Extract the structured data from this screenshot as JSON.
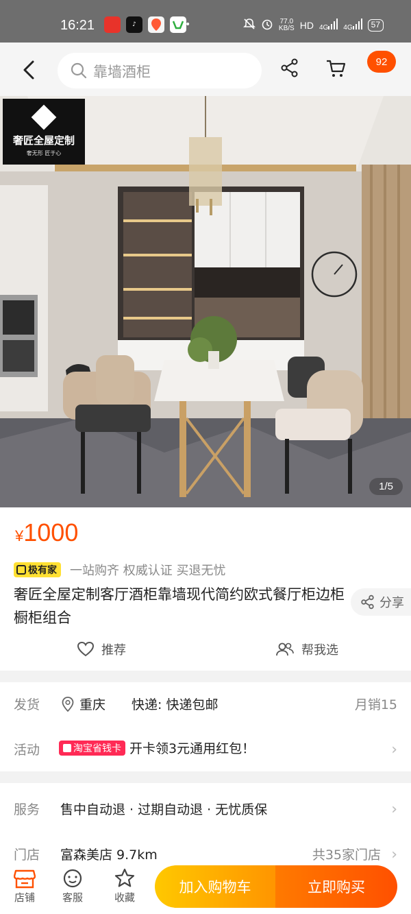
{
  "status_bar": {
    "time": "16:21",
    "net_speed_value": "77.0",
    "net_speed_unit": "KB/S",
    "hd": "HD",
    "signal1": "4G",
    "signal2": "4G",
    "battery": "57"
  },
  "nav": {
    "search_text": "靠墙酒柜",
    "cart_badge": "92"
  },
  "hero": {
    "brand_name": "奢匠全屋定制",
    "brand_sub": "奢无形 匠于心",
    "page_indicator": "1/5"
  },
  "product": {
    "currency": "¥",
    "price": "1000",
    "tag": "极有家",
    "slogan": "一站购齐 权威认证 买退无忧",
    "title": "奢匠全屋定制客厅酒柜靠墙现代简约欧式餐厅柜边柜橱柜组合",
    "share_label": "分享",
    "recommend_label": "推荐",
    "help_label": "帮我选"
  },
  "shipping": {
    "label": "发货",
    "location": "重庆",
    "express": "快递: 快递包邮",
    "monthly_sales": "月销15"
  },
  "activity": {
    "label": "活动",
    "tag": "淘宝省钱卡",
    "text": "开卡领3元通用红包！"
  },
  "service": {
    "label": "服务",
    "text": "售中自动退 · 过期自动退 · 无忧质保"
  },
  "store": {
    "label": "门店",
    "text": "富森美店 9.7km",
    "count": "共35家门店"
  },
  "bottom_bar": {
    "shop_label": "店铺",
    "service_label": "客服",
    "fav_label": "收藏",
    "add_cart_label": "加入购物车",
    "buy_now_label": "立即购买"
  },
  "colors": {
    "accent": "#ff5000",
    "add_cart": "#ffb000",
    "promo_tag": "#ff2a55",
    "tag_badge": "#ffe033"
  }
}
